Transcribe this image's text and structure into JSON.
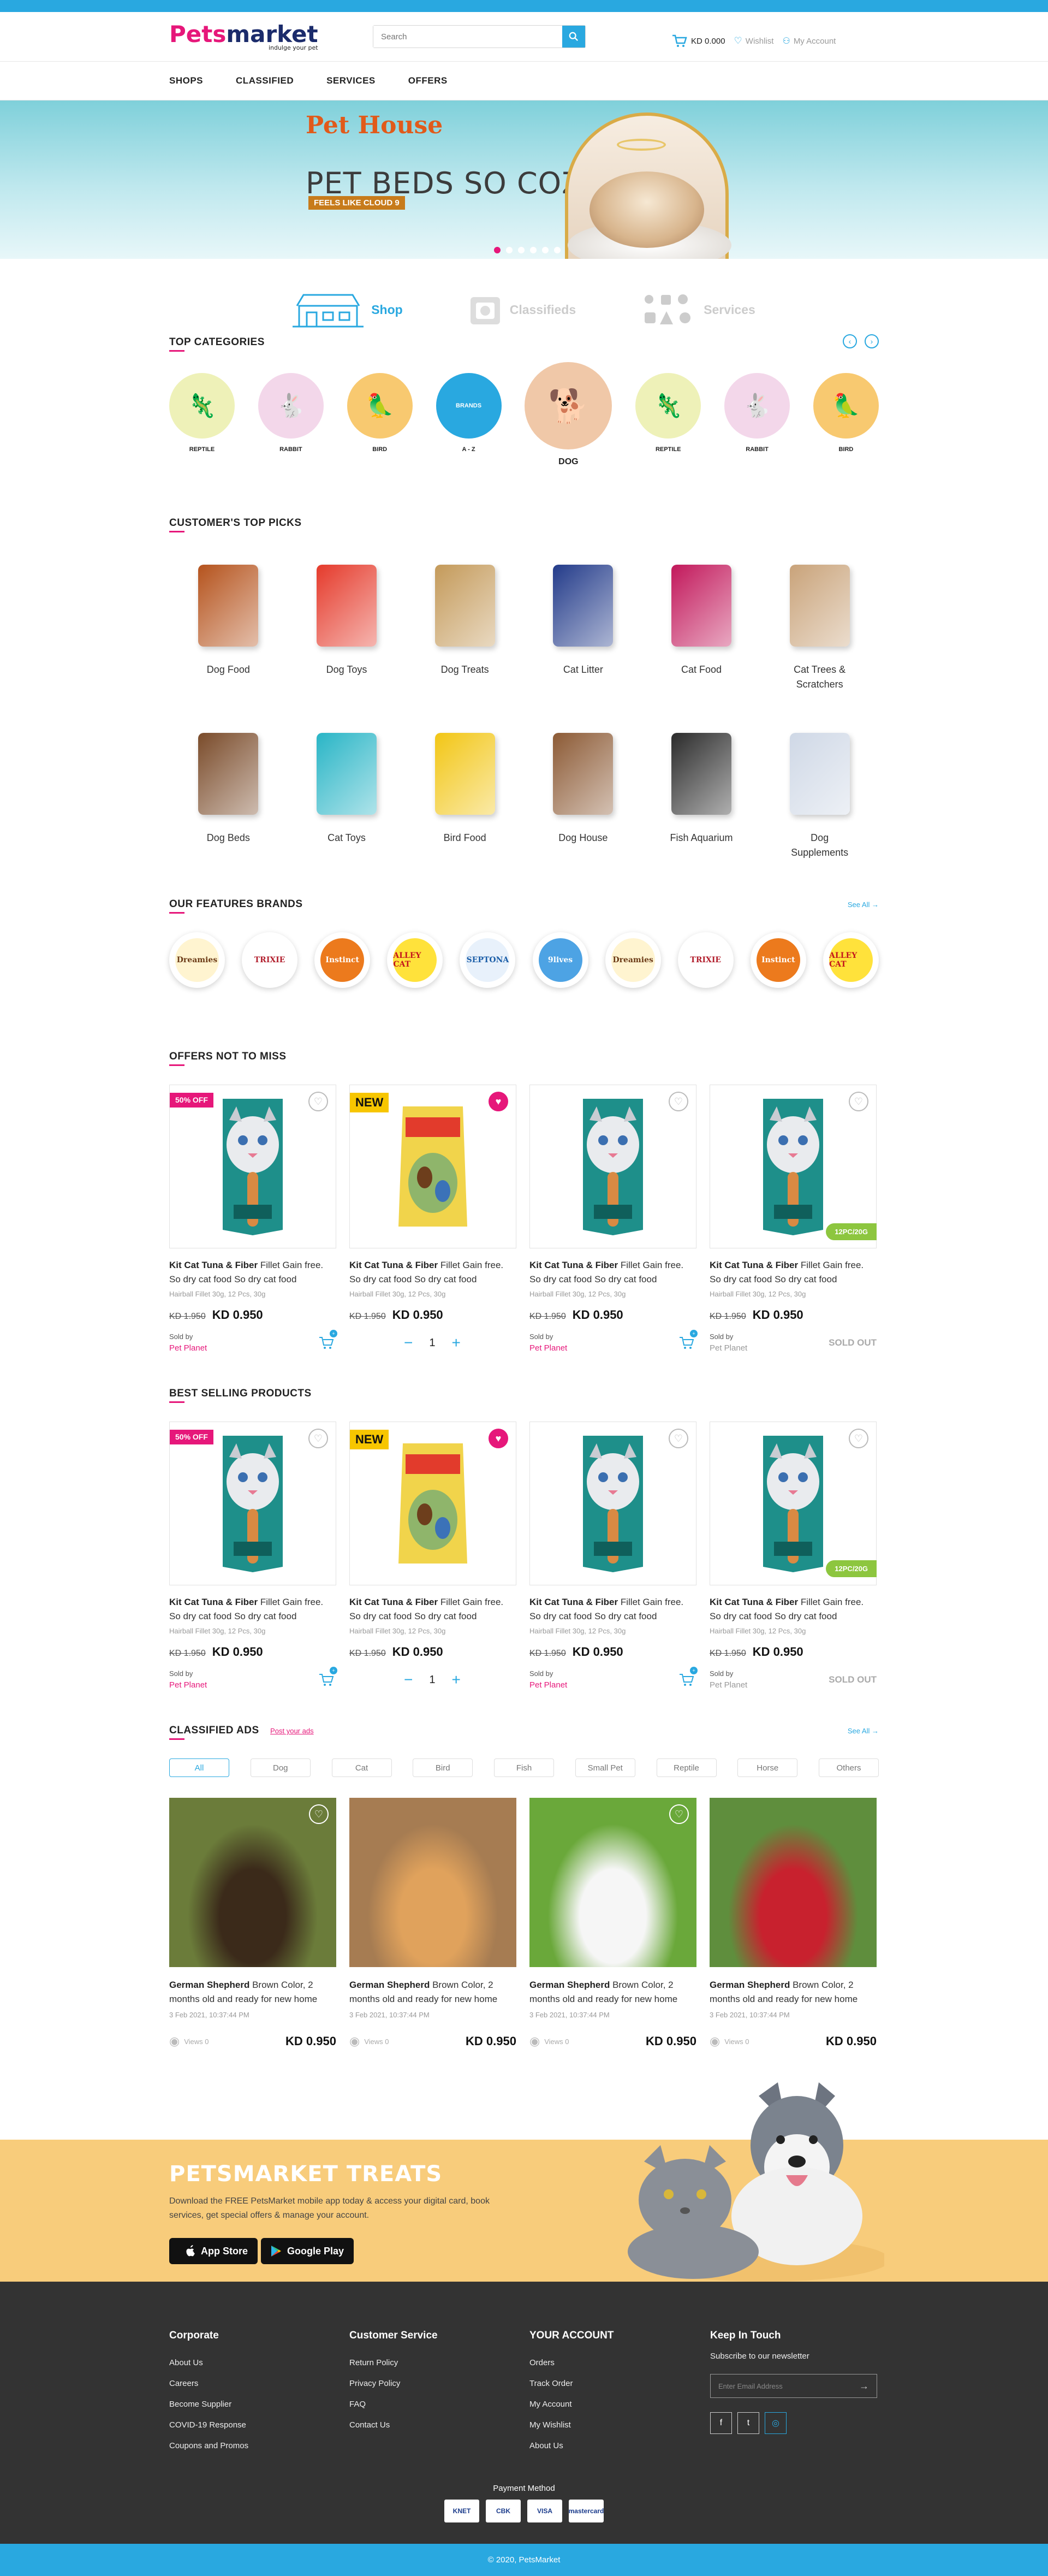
{
  "header": {
    "logo_part1": "Pets",
    "logo_part2": "market",
    "logo_tagline": "indulge your pet",
    "search_placeholder": "Search",
    "cart_amount": "KD 0.000",
    "wishlist": "Wishlist",
    "account": "My Account"
  },
  "nav": {
    "items": [
      "SHOPS",
      "CLASSIFIED",
      "SERVICES",
      "OFFERS"
    ]
  },
  "hero": {
    "brand": "Pet House",
    "headline": "PET BEDS SO COZY",
    "subline": "FEELS LIKE CLOUD 9",
    "slides": 6,
    "active_slide": 1
  },
  "services": [
    "Shop",
    "Classifieds",
    "Services"
  ],
  "top_categories": {
    "title": "TOP CATEGORIES",
    "items": [
      {
        "label": "REPTILE",
        "bg": "#eef1b8",
        "icon": "chameleon-icon"
      },
      {
        "label": "RABBIT",
        "bg": "#f3d7ea",
        "icon": "rabbit-icon"
      },
      {
        "label": "BIRD",
        "bg": "#f8c970",
        "icon": "parrot-icon"
      },
      {
        "label": "A - Z",
        "bg": "#29a8e0",
        "inner": "BRANDS",
        "icon": "brands-icon"
      },
      {
        "label": "DOG",
        "bg": "#f0c8a8",
        "icon": "dog-icon"
      },
      {
        "label": "REPTILE",
        "bg": "#eef1b8",
        "icon": "chameleon-icon"
      },
      {
        "label": "RABBIT",
        "bg": "#f3d7ea",
        "icon": "rabbit-icon"
      },
      {
        "label": "BIRD",
        "bg": "#f8c970",
        "icon": "parrot-icon"
      }
    ]
  },
  "top_picks": {
    "title": "CUSTOMER'S TOP PICKS",
    "items": [
      {
        "label": "Dog Food",
        "color": "#b5531d"
      },
      {
        "label": "Dog Toys",
        "color": "#e53a2b"
      },
      {
        "label": "Dog Treats",
        "color": "#c49a5a"
      },
      {
        "label": "Cat Litter",
        "color": "#233b8a"
      },
      {
        "label": "Cat Food",
        "color": "#c2185b"
      },
      {
        "label": "Cat Trees & Scratchers",
        "color": "#c9a37a"
      },
      {
        "label": "Dog Beds",
        "color": "#7a4b2a"
      },
      {
        "label": "Cat Toys",
        "color": "#29b5c6"
      },
      {
        "label": "Bird Food",
        "color": "#f2c615"
      },
      {
        "label": "Dog House",
        "color": "#8c5a35"
      },
      {
        "label": "Fish Aquarium",
        "color": "#2b2b2b"
      },
      {
        "label": "Dog Supplements",
        "color": "#cfd8e6"
      }
    ]
  },
  "brands": {
    "title": "OUR FEATURES BRANDS",
    "see_all": "See All",
    "items": [
      {
        "name": "Dreamies",
        "bg": "#fff4d0",
        "fg": "#6b3a16"
      },
      {
        "name": "TRIXIE",
        "bg": "#ffffff",
        "fg": "#b21f2d"
      },
      {
        "name": "Instinct",
        "bg": "#ec7a1d",
        "fg": "#ffffff"
      },
      {
        "name": "ALLEY CAT",
        "bg": "#ffe23b",
        "fg": "#c4161c"
      },
      {
        "name": "SEPTONA",
        "bg": "#e8f1fb",
        "fg": "#1b5ea8"
      },
      {
        "name": "9lives",
        "bg": "#4da3e4",
        "fg": "#ffffff"
      },
      {
        "name": "Dreamies",
        "bg": "#fff4d0",
        "fg": "#6b3a16"
      },
      {
        "name": "TRIXIE",
        "bg": "#ffffff",
        "fg": "#b21f2d"
      },
      {
        "name": "Instinct",
        "bg": "#ec7a1d",
        "fg": "#ffffff"
      },
      {
        "name": "ALLEY CAT",
        "bg": "#ffe23b",
        "fg": "#c4161c"
      }
    ]
  },
  "offers": {
    "title": "OFFERS NOT TO MISS",
    "products": [
      {
        "badge": "50% OFF",
        "badge_type": "sale",
        "wish": false,
        "kind": "cat",
        "name": "Kit Cat Tuna & Fiber",
        "desc": " Fillet Gain free. So dry cat food So dry cat food",
        "meta": "Hairball Fillet 30g, 12 Pcs, 30g",
        "old": "KD 1.950",
        "price": "KD 0.950",
        "sold_by": "Sold by",
        "seller": "Pet Planet",
        "action": "cart"
      },
      {
        "badge": "NEW",
        "badge_type": "new",
        "wish": true,
        "kind": "bird",
        "name": "Kit Cat Tuna & Fiber",
        "desc": " Fillet Gain free. So dry cat food So dry cat food",
        "meta": "Hairball Fillet 30g, 12 Pcs, 30g",
        "old": "KD 1.950",
        "price": "KD 0.950",
        "qty": "1",
        "action": "qty"
      },
      {
        "badge": "",
        "badge_type": "",
        "wish": false,
        "kind": "cat",
        "name": "Kit Cat Tuna & Fiber",
        "desc": " Fillet Gain free. So dry cat food So dry cat food",
        "meta": "Hairball Fillet 30g, 12 Pcs, 30g",
        "old": "KD 1.950",
        "price": "KD 0.950",
        "sold_by": "Sold by",
        "seller": "Pet Planet",
        "action": "cart"
      },
      {
        "badge": "",
        "badge_type": "",
        "wish": false,
        "kind": "cat",
        "pack": "12PC/20G",
        "name": "Kit Cat Tuna & Fiber",
        "desc": " Fillet Gain free. So dry cat food So dry cat food",
        "meta": "Hairball Fillet 30g, 12 Pcs, 30g",
        "old": "KD 1.950",
        "price": "KD 0.950",
        "sold_by": "Sold by",
        "seller": "Pet Planet",
        "action": "sold",
        "sold_label": "SOLD OUT"
      }
    ]
  },
  "best": {
    "title": "BEST SELLING PRODUCTS",
    "products": [
      {
        "badge": "50% OFF",
        "badge_type": "sale",
        "wish": false,
        "kind": "cat",
        "name": "Kit Cat Tuna & Fiber",
        "desc": " Fillet Gain free. So dry cat food So dry cat food",
        "meta": "Hairball Fillet 30g, 12 Pcs, 30g",
        "old": "KD 1.950",
        "price": "KD 0.950",
        "sold_by": "Sold by",
        "seller": "Pet Planet",
        "action": "cart"
      },
      {
        "badge": "NEW",
        "badge_type": "new",
        "wish": true,
        "kind": "bird",
        "name": "Kit Cat Tuna & Fiber",
        "desc": " Fillet Gain free. So dry cat food So dry cat food",
        "meta": "Hairball Fillet 30g, 12 Pcs, 30g",
        "old": "KD 1.950",
        "price": "KD 0.950",
        "qty": "1",
        "action": "qty"
      },
      {
        "badge": "",
        "badge_type": "",
        "wish": false,
        "kind": "cat",
        "name": "Kit Cat Tuna & Fiber",
        "desc": " Fillet Gain free. So dry cat food So dry cat food",
        "meta": "Hairball Fillet 30g, 12 Pcs, 30g",
        "old": "KD 1.950",
        "price": "KD 0.950",
        "sold_by": "Sold by",
        "seller": "Pet Planet",
        "action": "cart"
      },
      {
        "badge": "",
        "badge_type": "",
        "wish": false,
        "kind": "cat",
        "pack": "12PC/20G",
        "name": "Kit Cat Tuna & Fiber",
        "desc": " Fillet Gain free. So dry cat food So dry cat food",
        "meta": "Hairball Fillet 30g, 12 Pcs, 30g",
        "old": "KD 1.950",
        "price": "KD 0.950",
        "sold_by": "Sold by",
        "seller": "Pet Planet",
        "action": "sold",
        "sold_label": "SOLD OUT"
      }
    ]
  },
  "classified": {
    "title": "CLASSIFIED ADS",
    "post_link": "Post your ads",
    "see_all": "See All",
    "filters": [
      "All",
      "Dog",
      "Cat",
      "Bird",
      "Fish",
      "Small Pet",
      "Reptile",
      "Horse",
      "Others"
    ],
    "active_filter": 0,
    "ads": [
      {
        "name": "German Shepherd",
        "desc": " Brown Color, 2 months old and ready for new home",
        "date": "3 Feb 2021, 10:37:44 PM",
        "views": "Views 0",
        "price": "KD 0.950",
        "wish": true,
        "bg": "#6b7c3a",
        "fg": "#3b2a1a"
      },
      {
        "name": "German Shepherd",
        "desc": " Brown Color, 2 months old and ready for new home",
        "date": "3 Feb 2021, 10:37:44 PM",
        "views": "Views 0",
        "price": "KD 0.950",
        "wish": false,
        "bg": "#a67c52",
        "fg": "#e0a25c"
      },
      {
        "name": "German Shepherd",
        "desc": " Brown Color, 2 months old and ready for new home",
        "date": "3 Feb 2021, 10:37:44 PM",
        "views": "Views 0",
        "price": "KD 0.950",
        "wish": true,
        "bg": "#6aa83a",
        "fg": "#f6f6f6"
      },
      {
        "name": "German Shepherd",
        "desc": " Brown Color, 2 months old and ready for new home",
        "date": "3 Feb 2021, 10:37:44 PM",
        "views": "Views 0",
        "price": "KD 0.950",
        "wish": false,
        "bg": "#5f8e3d",
        "fg": "#c8212e"
      }
    ]
  },
  "treats": {
    "title": "PETSMARKET TREATS",
    "text": "Download the FREE PetsMarket mobile app today & access your digital card, book services, get special offers & manage your account.",
    "app_store": "App Store",
    "google_play": "Google Play"
  },
  "footer": {
    "columns": [
      {
        "title": "Corporate",
        "links": [
          "About Us",
          "Careers",
          "Become Supplier",
          "COVID-19 Response",
          "Coupons and Promos"
        ]
      },
      {
        "title": "Customer Service",
        "links": [
          "Return Policy",
          "Privacy Policy",
          "FAQ",
          "Contact Us"
        ]
      },
      {
        "title": "YOUR ACCOUNT",
        "links": [
          "Orders",
          "Track Order",
          "My Account",
          "My Wishlist",
          "About Us"
        ]
      }
    ],
    "keep_title": "Keep In Touch",
    "subscribe": "Subscribe to our newsletter",
    "email_placeholder": "Enter Email Address",
    "payment_title": "Payment Method",
    "payments": [
      "KNET",
      "CBK",
      "VISA",
      "mastercard"
    ],
    "copyright": "© 2020, PetsMarket"
  },
  "colors": {
    "accent": "#29a8e0",
    "brand_pink": "#e6177a",
    "treats_bg": "#f8cc7b",
    "footer_bg": "#333333"
  }
}
